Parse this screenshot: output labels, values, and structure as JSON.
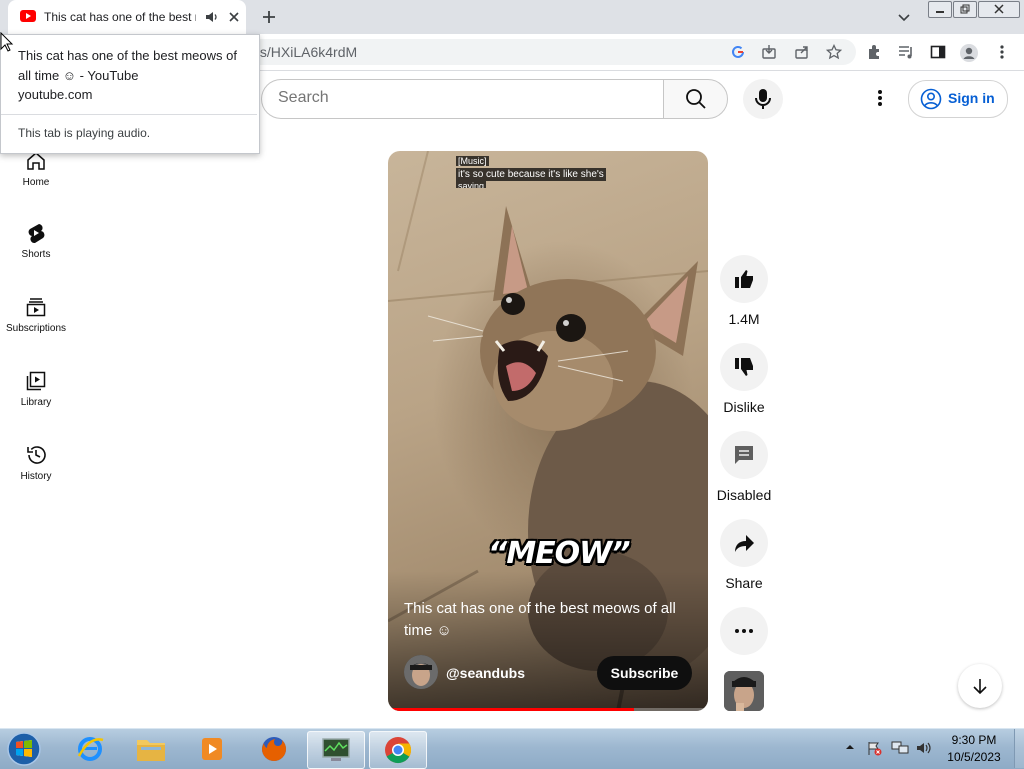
{
  "browser": {
    "tab_title": "This cat has one of the best meows of all time ☺ - YouTube",
    "url_visible": "ts/HXiLA6k4rdM"
  },
  "hover_card": {
    "title": "This cat has one of the best meows of all time ☺ - YouTube",
    "domain": "youtube.com",
    "audio_status": "This tab is playing audio."
  },
  "masthead": {
    "search_placeholder": "Search",
    "sign_in_label": "Sign in"
  },
  "guide": {
    "items": [
      {
        "label": "Home",
        "icon": "home-icon"
      },
      {
        "label": "Shorts",
        "icon": "shorts-icon"
      },
      {
        "label": "Subscriptions",
        "icon": "subscriptions-icon"
      },
      {
        "label": "Library",
        "icon": "library-icon"
      },
      {
        "label": "History",
        "icon": "history-icon"
      }
    ]
  },
  "short": {
    "caption_music": "[Music]",
    "caption_line": "it's so cute because it's like she's",
    "caption_cut": "saying",
    "overlay_text": "“MEOW”",
    "title": "This cat has one of the best meows of all time ☺",
    "channel": "@seandubs",
    "subscribe_label": "Subscribe",
    "progress_fraction": 0.77
  },
  "actions": {
    "likes": "1.4M",
    "dislike": "Dislike",
    "comments": "Disabled",
    "share": "Share"
  },
  "taskbar": {
    "time": "9:30 PM",
    "date": "10/5/2023"
  },
  "colors": {
    "youtube_red": "#ff0000",
    "link_blue": "#065fd4",
    "taskbar": "#9db7d0"
  }
}
